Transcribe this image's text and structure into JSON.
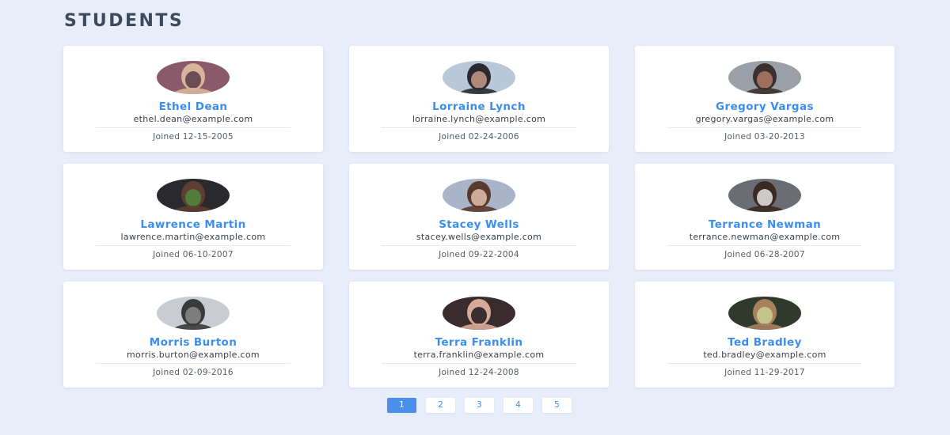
{
  "page": {
    "title": "STUDENTS"
  },
  "students": [
    {
      "name": "Ethel Dean",
      "email": "ethel.dean@example.com",
      "joined": "Joined 12-15-2005",
      "avatar_colors": [
        "#8a5a6a",
        "#d7b49a",
        "#5b3a4a"
      ]
    },
    {
      "name": "Lorraine Lynch",
      "email": "lorraine.lynch@example.com",
      "joined": "Joined 02-24-2006",
      "avatar_colors": [
        "#b8c8d8",
        "#2a2a30",
        "#c79a86"
      ]
    },
    {
      "name": "Gregory Vargas",
      "email": "gregory.vargas@example.com",
      "joined": "Joined 03-20-2013",
      "avatar_colors": [
        "#9aa0a8",
        "#3a3030",
        "#b07a62"
      ]
    },
    {
      "name": "Lawrence Martin",
      "email": "lawrence.martin@example.com",
      "joined": "Joined 06-10-2007",
      "avatar_colors": [
        "#2a2a2e",
        "#5e3e32",
        "#4d8a3a"
      ]
    },
    {
      "name": "Stacey Wells",
      "email": "stacey.wells@example.com",
      "joined": "Joined 09-22-2004",
      "avatar_colors": [
        "#a9b4c9",
        "#5a3a2c",
        "#e3c0aa"
      ]
    },
    {
      "name": "Terrance Newman",
      "email": "terrance.newman@example.com",
      "joined": "Joined 06-28-2007",
      "avatar_colors": [
        "#6a6e74",
        "#3a2a22",
        "#e6e6e6"
      ]
    },
    {
      "name": "Morris Burton",
      "email": "morris.burton@example.com",
      "joined": "Joined 02-09-2016",
      "avatar_colors": [
        "#c9ccd0",
        "#3a3a3a",
        "#8a8a8a"
      ]
    },
    {
      "name": "Terra Franklin",
      "email": "terra.franklin@example.com",
      "joined": "Joined 12-24-2008",
      "avatar_colors": [
        "#3a2b2e",
        "#d7aa98",
        "#1e1a1c"
      ]
    },
    {
      "name": "Ted Bradley",
      "email": "ted.bradley@example.com",
      "joined": "Joined 11-29-2017",
      "avatar_colors": [
        "#2f3a2c",
        "#a8805e",
        "#c8d090"
      ]
    }
  ],
  "pagination": {
    "pages": [
      "1",
      "2",
      "3",
      "4",
      "5"
    ],
    "active": "1",
    "active_color": "#4a90ea"
  },
  "colors": {
    "background": "#e8eef9",
    "accent": "#3b8ef0",
    "title": "#3d4a5e"
  }
}
